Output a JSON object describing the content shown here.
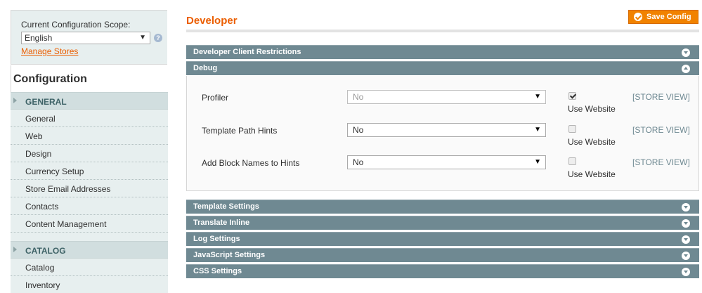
{
  "sidebar": {
    "scope_label": "Current Configuration Scope:",
    "scope_value": "English",
    "scope_help_icon": "help-icon",
    "manage_stores": "Manage Stores",
    "config_title": "Configuration",
    "groups": [
      {
        "label": "GENERAL",
        "items": [
          "General",
          "Web",
          "Design",
          "Currency Setup",
          "Store Email Addresses",
          "Contacts",
          "Content Management"
        ]
      },
      {
        "label": "CATALOG",
        "items": [
          "Catalog",
          "Inventory"
        ]
      }
    ]
  },
  "main": {
    "title": "Developer",
    "save_label": "Save Config",
    "sections": {
      "client_restrictions": "Developer Client Restrictions",
      "debug": "Debug",
      "template": "Template Settings",
      "translate": "Translate Inline",
      "log": "Log Settings",
      "javascript": "JavaScript Settings",
      "css": "CSS Settings"
    },
    "debug_fields": [
      {
        "label": "Profiler",
        "value": "No",
        "use_website": "Use Website",
        "use_website_checked": true,
        "scope": "[STORE VIEW]"
      },
      {
        "label": "Template Path Hints",
        "value": "No",
        "use_website": "Use Website",
        "use_website_checked": false,
        "scope": "[STORE VIEW]"
      },
      {
        "label": "Add Block Names to Hints",
        "value": "No",
        "use_website": "Use Website",
        "use_website_checked": false,
        "scope": "[STORE VIEW]"
      }
    ]
  },
  "colors": {
    "accent": "#eb5e00",
    "button": "#f18200",
    "section_header": "#6f8992",
    "sidebar_bg": "#e7efef",
    "sidebar_header_bg": "#d1dedf"
  }
}
